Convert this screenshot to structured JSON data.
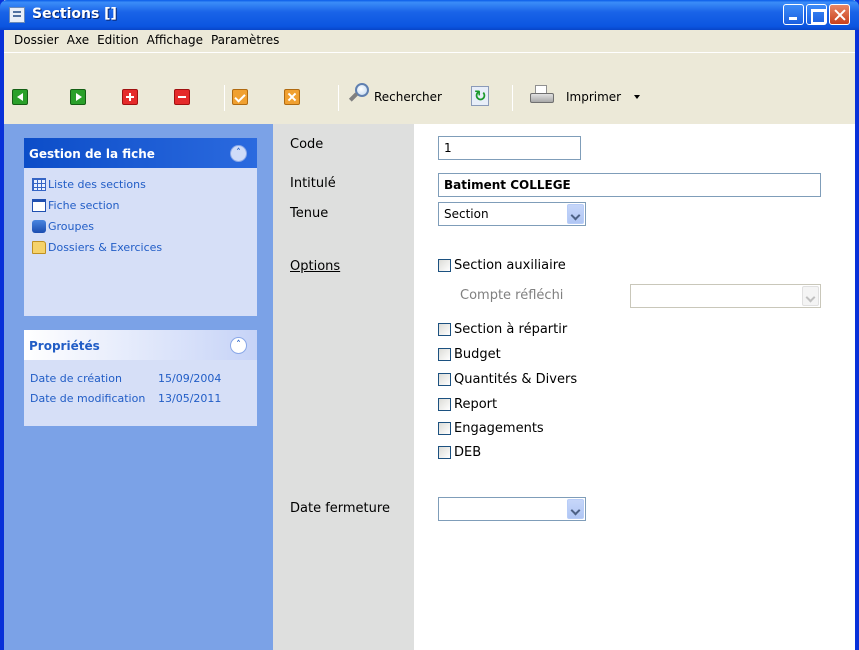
{
  "window": {
    "title": "Sections []"
  },
  "menu": [
    "Dossier",
    "Axe",
    "Edition",
    "Affichage",
    "Paramètres"
  ],
  "toolbar": {
    "search_label": "Rechercher",
    "print_label": "Imprimer"
  },
  "sidebar": {
    "gestion": {
      "title": "Gestion de la fiche",
      "items": [
        {
          "label": "Liste des sections",
          "icon": "grid-icon"
        },
        {
          "label": "Fiche section",
          "icon": "form-icon"
        },
        {
          "label": "Groupes",
          "icon": "group-icon"
        },
        {
          "label": "Dossiers & Exercices",
          "icon": "folder-icon"
        }
      ]
    },
    "proprietes": {
      "title": "Propriétés",
      "rows": [
        {
          "key": "Date de création",
          "value": "15/09/2004"
        },
        {
          "key": "Date de modification",
          "value": "13/05/2011"
        }
      ]
    }
  },
  "form": {
    "code_label": "Code",
    "code_value": "1",
    "intitule_label": "Intitulé",
    "intitule_value": "Batiment COLLEGE",
    "tenue_label": "Tenue",
    "tenue_value": "Section",
    "options_label": "Options",
    "section_auxiliaire": "Section auxiliaire",
    "compte_reflechi": "Compte réfléchi",
    "checkboxes": [
      "Section à répartir",
      "Budget",
      "Quantités & Divers",
      "Report",
      "Engagements",
      "DEB"
    ],
    "date_fermeture_label": "Date fermeture"
  }
}
